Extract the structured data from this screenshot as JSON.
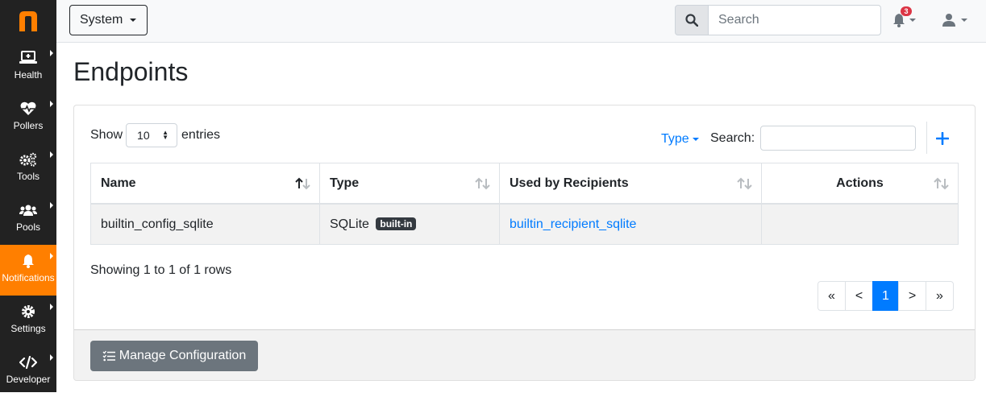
{
  "app": {
    "logo_icon": "n-logo-icon",
    "accent_color": "#ff7f00"
  },
  "sidebar": {
    "items": [
      {
        "label": "Health",
        "icon": "laptop-medical-icon"
      },
      {
        "label": "Pollers",
        "icon": "heartbeat-icon"
      },
      {
        "label": "Tools",
        "icon": "cogs-icon"
      },
      {
        "label": "Pools",
        "icon": "users-icon"
      },
      {
        "label": "Notifications",
        "icon": "bell-icon",
        "active": true
      },
      {
        "label": "Settings",
        "icon": "cog-icon"
      },
      {
        "label": "Developer",
        "icon": "code-icon"
      }
    ]
  },
  "topbar": {
    "context_label": "System",
    "search_placeholder": "Search",
    "notification_count": "3"
  },
  "page": {
    "title": "Endpoints"
  },
  "table_controls": {
    "show_label": "Show",
    "page_size": "10",
    "entries_label": "entries",
    "type_filter_label": "Type",
    "search_label": "Search:",
    "search_value": ""
  },
  "table": {
    "columns": [
      "Name",
      "Type",
      "Used by Recipients",
      "Actions"
    ],
    "rows": [
      {
        "name": "builtin_config_sqlite",
        "type": "SQLite",
        "badge": "built-in",
        "recipients": "builtin_recipient_sqlite",
        "actions": ""
      }
    ]
  },
  "footer_info": {
    "showing_text": "Showing 1 to 1 of 1 rows"
  },
  "pagination": {
    "first": "«",
    "prev": "<",
    "current": "1",
    "next": ">",
    "last": "»"
  },
  "card_footer": {
    "manage_label": "Manage Configuration"
  },
  "colors": {
    "primary": "#007bff",
    "secondary": "#6c757d",
    "danger": "#dc3545",
    "sidebar_bg": "#222222"
  }
}
